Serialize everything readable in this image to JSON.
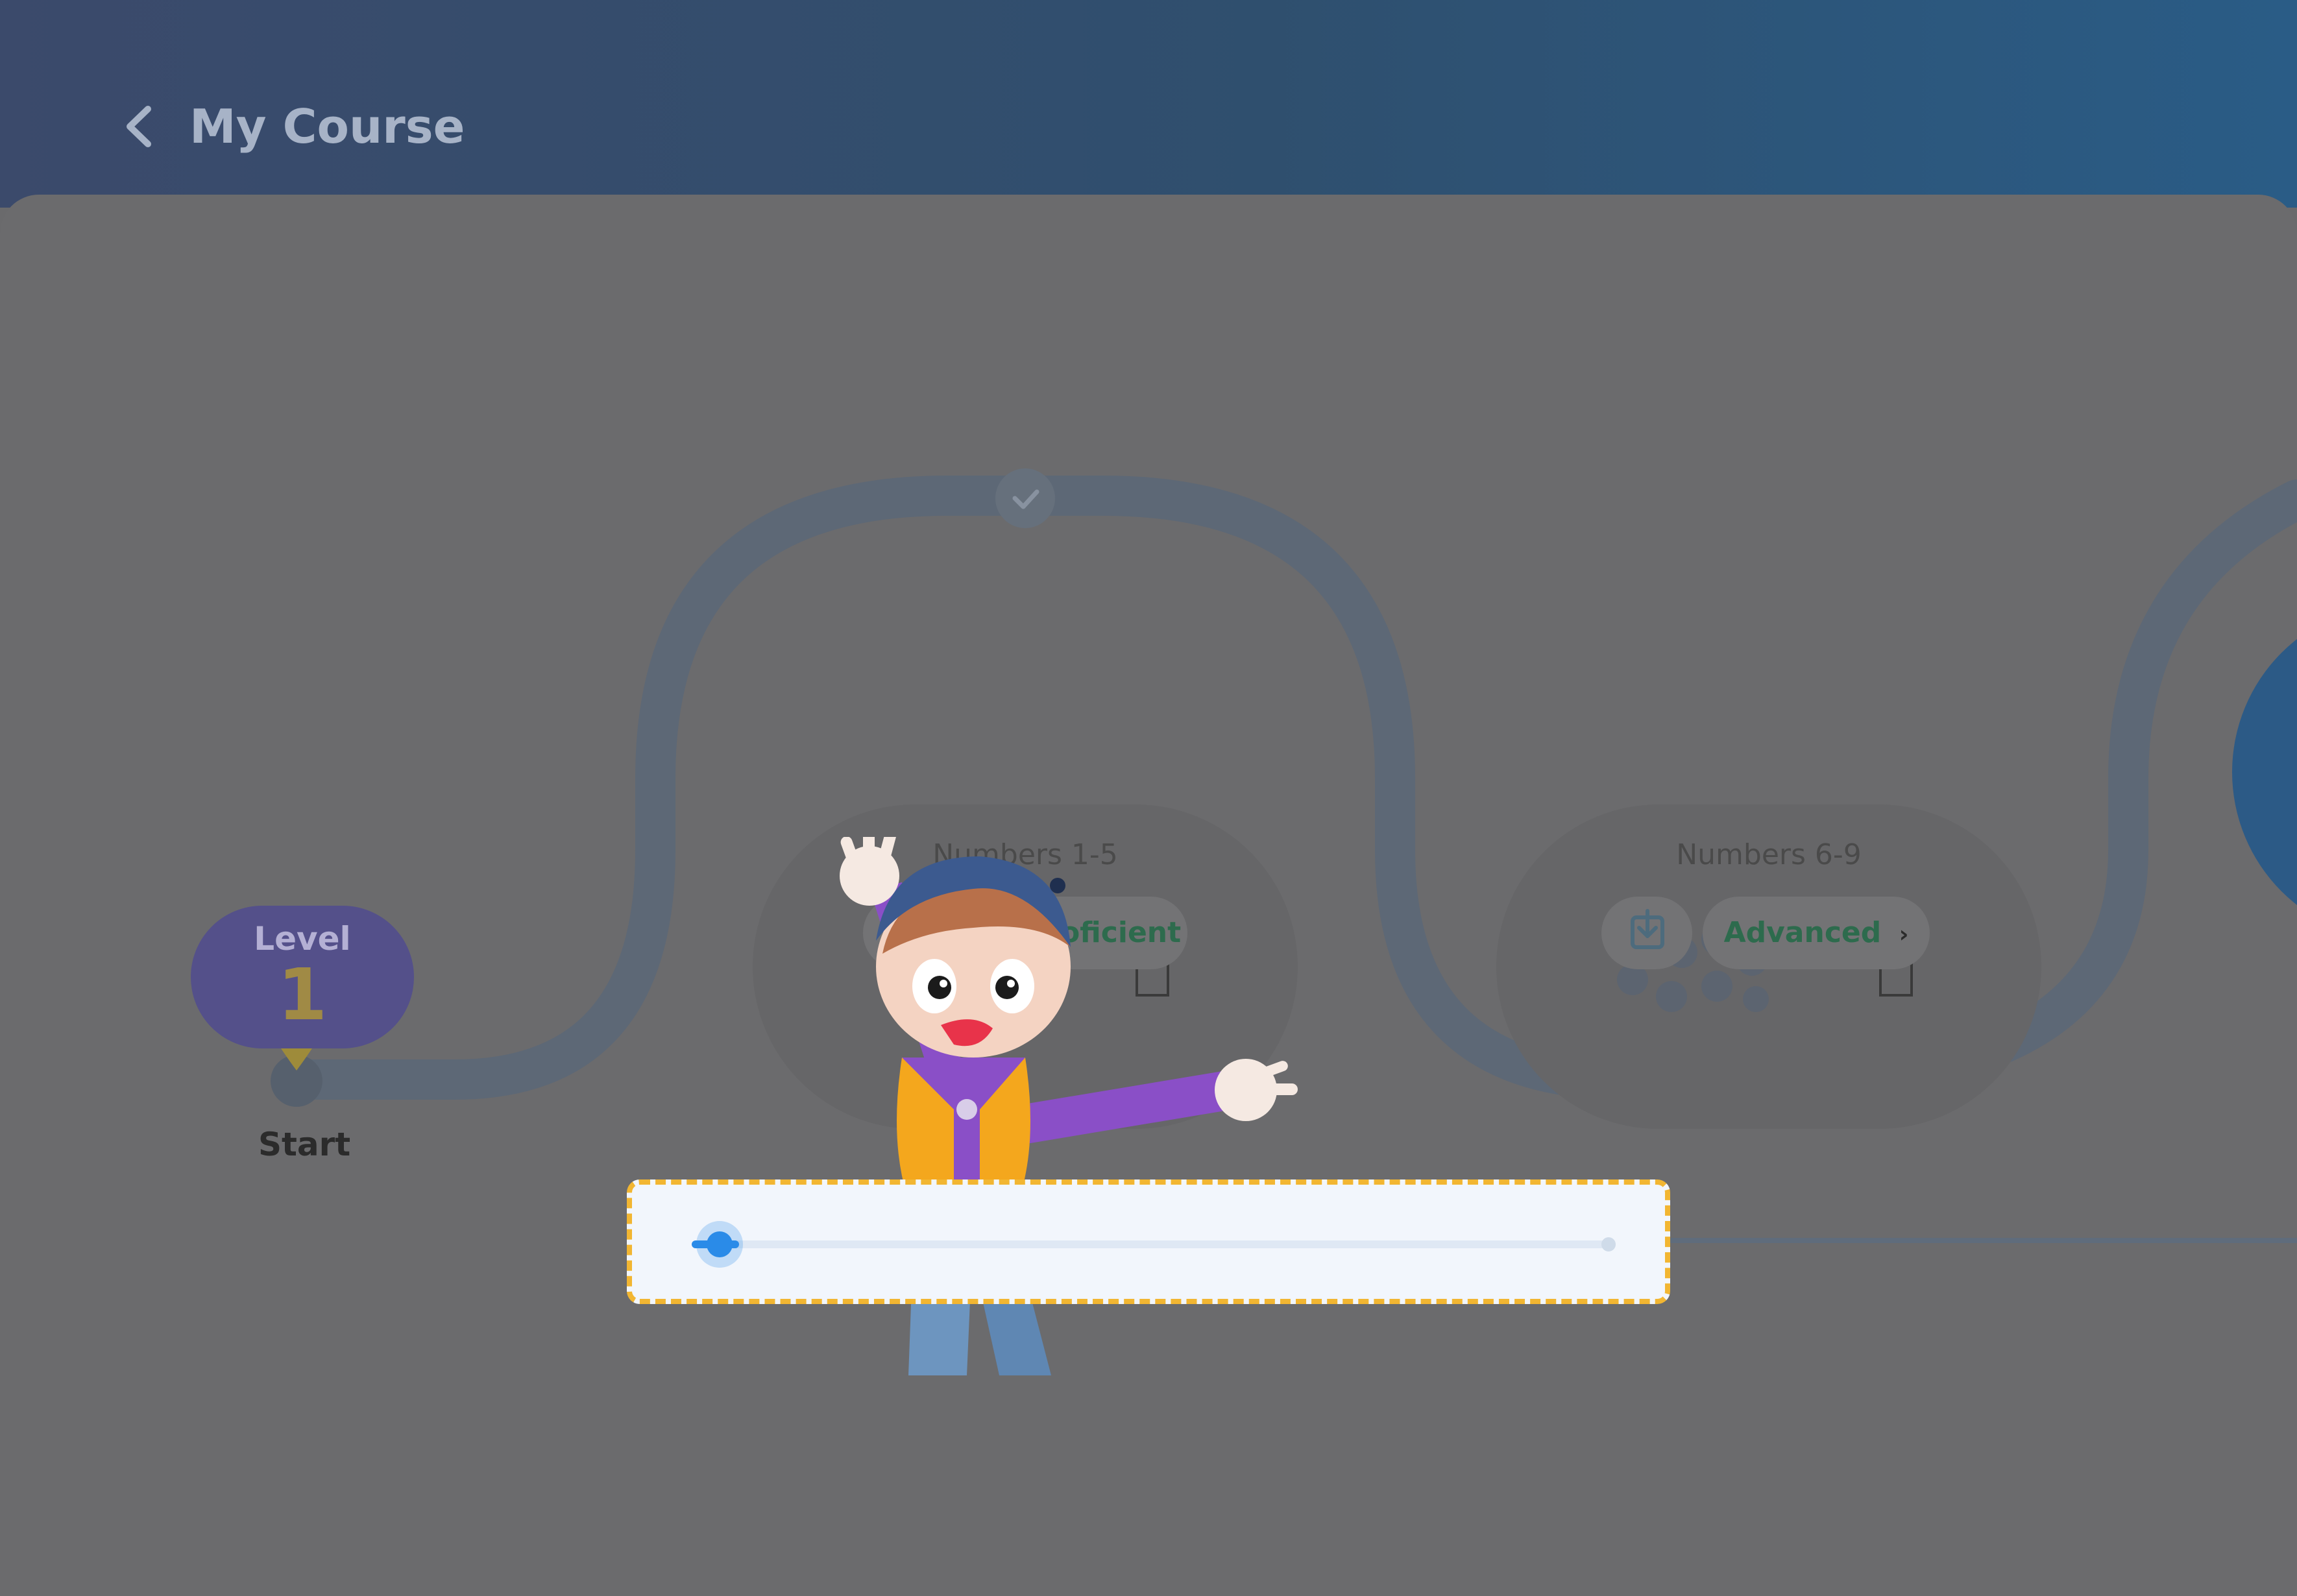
{
  "header": {
    "title": "My Course",
    "back_icon": "chevron-left-icon"
  },
  "level": {
    "label": "Level",
    "number": "1"
  },
  "start": {
    "label": "Start",
    "icon": "map-pin-icon"
  },
  "units": [
    {
      "title": "Numbers 1-5",
      "level_label": "Proficient",
      "completed": true
    },
    {
      "title": "Numbers 6-9",
      "level_label": "Advanced",
      "completed": true
    }
  ],
  "slider": {
    "value": 0.03
  },
  "colors": {
    "header_start": "#3b4a6b",
    "header_end": "#2a5c86",
    "accent": "#2a8be8",
    "highlight_border": "#f2b632",
    "level_badge": "#54508a"
  }
}
